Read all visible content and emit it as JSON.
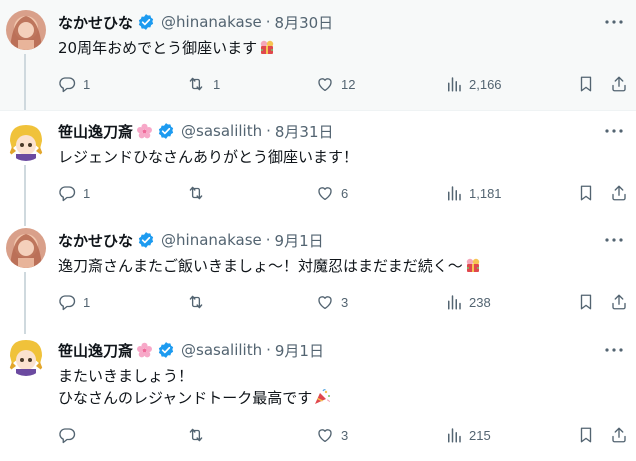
{
  "tweets": [
    {
      "name": "なかせひな",
      "handle": "@hinanakase",
      "sep": "·",
      "date": "8月30日",
      "lines": [
        "20周年おめでとう御座います"
      ],
      "replies": "1",
      "retweets": "1",
      "likes": "12",
      "views": "2,166",
      "line_emoji": [
        "gift-emoji"
      ]
    },
    {
      "name": "笹山逸刀斎",
      "handle": "@sasalilith",
      "sep": "·",
      "date": "8月31日",
      "lines": [
        "レジェンドひなさんありがとう御座います！"
      ],
      "replies": "1",
      "retweets": "",
      "likes": "6",
      "views": "1,181",
      "line_emoji": [
        ""
      ]
    },
    {
      "name": "なかせひな",
      "handle": "@hinanakase",
      "sep": "·",
      "date": "9月1日",
      "lines": [
        "逸刀斎さんまたご飯いきましょ〜！対魔忍はまだまだ続く〜"
      ],
      "replies": "1",
      "retweets": "",
      "likes": "3",
      "views": "238",
      "line_emoji": [
        "gift-emoji"
      ]
    },
    {
      "name": "笹山逸刀斎",
      "handle": "@sasalilith",
      "sep": "·",
      "date": "9月1日",
      "lines": [
        "またいきましょう！",
        "ひなさんのレジャンドトーク最高です"
      ],
      "replies": "",
      "retweets": "",
      "likes": "3",
      "views": "215",
      "line_emoji": [
        "",
        "party-popper-emoji"
      ]
    }
  ],
  "colors": {
    "text": "#0f1419",
    "muted": "#536471",
    "verified": "#1d9bf0",
    "highlight_bg": "#f7f9f9",
    "divider": "#eff3f4"
  },
  "icons": [
    "reply-icon",
    "retweet-icon",
    "like-icon",
    "views-icon",
    "bookmark-icon",
    "share-icon",
    "more-icon",
    "verified-badge-icon",
    "cherry-blossom-icon"
  ]
}
